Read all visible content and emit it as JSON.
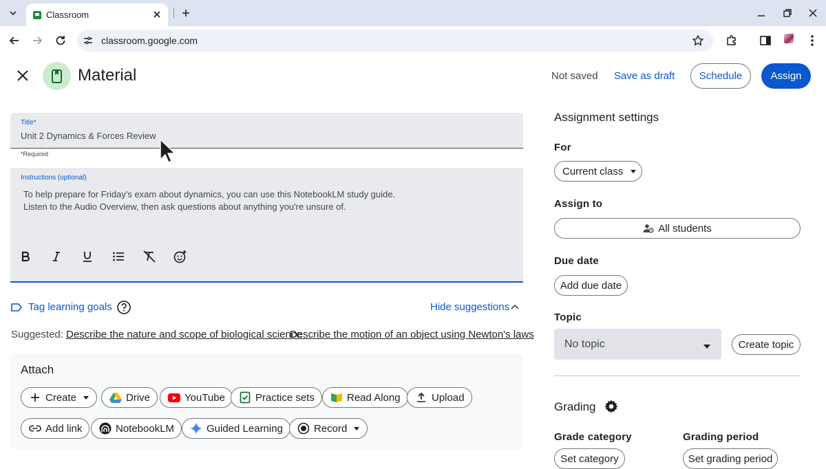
{
  "browser": {
    "tab_title": "Classroom",
    "url": "classroom.google.com"
  },
  "header": {
    "page_title": "Material",
    "status": "Not saved",
    "save_draft": "Save as draft",
    "schedule": "Schedule",
    "assign": "Assign"
  },
  "form": {
    "title_label": "Title*",
    "title_value": "Unit 2 Dynamics & Forces Review",
    "required_note": "*Required",
    "instructions_label": "Instructions (optional)",
    "instructions_line1": "To help prepare for Friday's exam about dynamics, you can use this NotebookLM study guide.",
    "instructions_line2": "Listen to the Audio Overview, then ask questions about anything you're unsure of.",
    "format_tools": [
      "bold-icon",
      "italic-icon",
      "underline-icon",
      "bulleted-list-icon",
      "clear-formatting-icon",
      "add-emoji-icon"
    ]
  },
  "goals": {
    "tag_label": "Tag learning goals",
    "hide_label": "Hide suggestions",
    "suggested_label": "Suggested:",
    "suggestions": [
      "Describe the nature and scope of biological science",
      "Describe the motion of an object using Newton's laws"
    ]
  },
  "attach": {
    "heading": "Attach",
    "row1": [
      "Create",
      "Drive",
      "YouTube",
      "Practice sets",
      "Read Along",
      "Upload"
    ],
    "row2": [
      "Add link",
      "NotebookLM",
      "Guided Learning",
      "Record"
    ]
  },
  "settings": {
    "heading": "Assignment settings",
    "for_label": "For",
    "for_value": "Current class",
    "assign_to_label": "Assign to",
    "assign_to_value": "All students",
    "due_label": "Due date",
    "due_button": "Add due date",
    "topic_label": "Topic",
    "topic_value": "No topic",
    "create_topic": "Create topic",
    "grading_heading": "Grading",
    "grade_category_label": "Grade category",
    "grade_category_button": "Set category",
    "grading_period_label": "Grading period",
    "grading_period_button": "Set grading period"
  },
  "colors": {
    "accent": "#0b57d0",
    "field_bg": "#e8eaed",
    "tabbar_bg": "#dde3f0",
    "material_icon_bg": "#cdeccf"
  }
}
